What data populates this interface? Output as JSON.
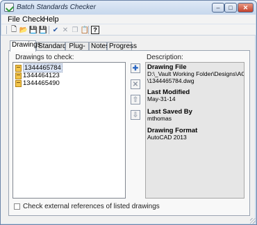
{
  "window": {
    "title": "Batch Standards Checker"
  },
  "menu": [
    "File",
    "Check",
    "Help"
  ],
  "tabs": [
    "Drawings",
    "Standards",
    "Plug-ins",
    "Notes",
    "Progress"
  ],
  "drawings_label": "Drawings to check:",
  "drawings": [
    "1344465784",
    "1344464123",
    "1344465490"
  ],
  "description_label": "Description:",
  "description": {
    "file_heading": "Drawing File",
    "file_path_line1": "D:\\_Vault Working Folder\\Designs\\ACAD",
    "file_path_line2": "\\1344465784.dwg",
    "modified_heading": "Last Modified",
    "modified_value": "May-31-14",
    "saved_heading": "Last Saved By",
    "saved_value": "mthomas",
    "format_heading": "Drawing Format",
    "format_value": "AutoCAD 2013"
  },
  "checkbox_label": "Check external references of listed drawings",
  "icons": {
    "new": "new-document-icon",
    "open": "open-folder-icon",
    "save": "save-icon",
    "save_as": "save-as-icon",
    "check": "check-icon",
    "delete": "delete-icon",
    "copy": "copy-icon",
    "paste": "paste-icon",
    "help": "help-icon"
  },
  "colors": {
    "title_bar": "#c9d8ea",
    "close": "#c4412c",
    "description_bg": "#e6e6e6"
  }
}
